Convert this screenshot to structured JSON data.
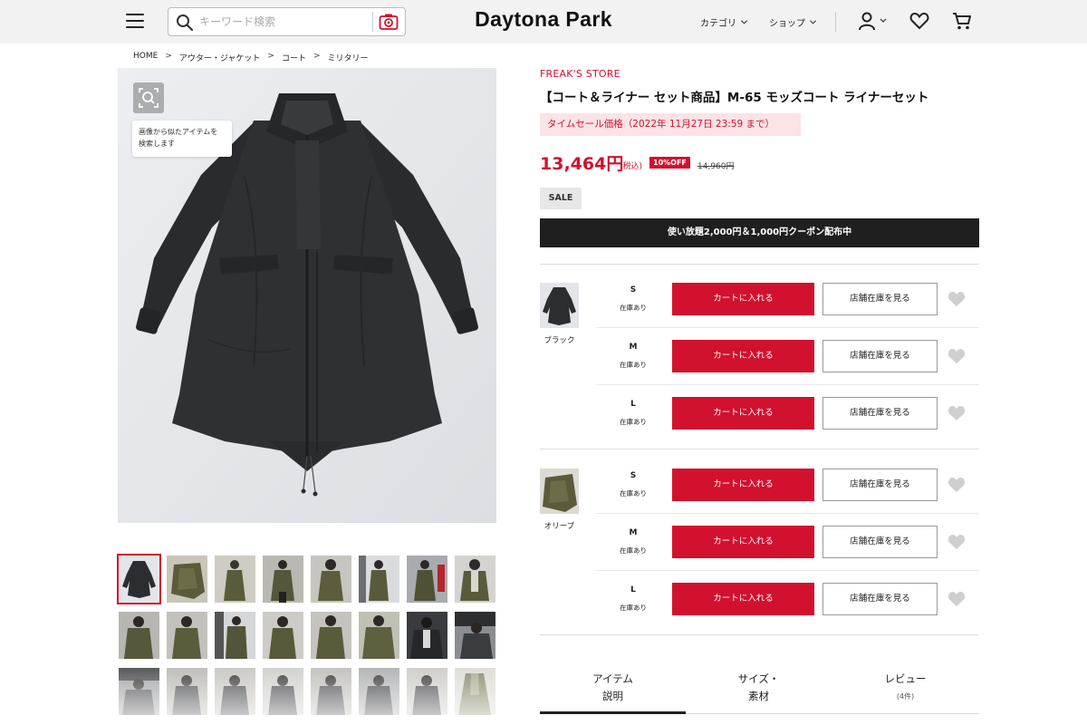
{
  "header": {
    "logo": "Daytona Park",
    "search_placeholder": "キーワード検索",
    "nav": [
      {
        "label": "カテゴリ"
      },
      {
        "label": "ショップ"
      }
    ]
  },
  "breadcrumb": [
    "HOME",
    "アウター・ジャケット",
    "コート",
    "ミリタリー"
  ],
  "image_search": {
    "tooltip_line1": "画像から似たアイテムを",
    "tooltip_line2": "検索します"
  },
  "product": {
    "brand": "FREAK'S STORE",
    "title": "【コート＆ライナー セット商品】M-65 モッズコート ライナーセット",
    "sale_banner": "タイムセール価格（2022年 11月27日 23:59 まで）",
    "price": "13,464円",
    "tax_note": "(税込)",
    "discount_badge": "10%OFF",
    "original_price": "14,960円",
    "sale_tag": "SALE",
    "coupon_banner": "使い放題2,000円＆1,000円クーポン配布中"
  },
  "variants": [
    {
      "color": "ブラック",
      "sizes": [
        {
          "size": "S",
          "stock": "在庫あり",
          "cart_label": "カートに入れる",
          "store_label": "店舗在庫を見る"
        },
        {
          "size": "M",
          "stock": "在庫あり",
          "cart_label": "カートに入れる",
          "store_label": "店舗在庫を見る"
        },
        {
          "size": "L",
          "stock": "在庫あり",
          "cart_label": "カートに入れる",
          "store_label": "店舗在庫を見る"
        }
      ]
    },
    {
      "color": "オリーブ",
      "sizes": [
        {
          "size": "S",
          "stock": "在庫あり",
          "cart_label": "カートに入れる",
          "store_label": "店舗在庫を見る"
        },
        {
          "size": "M",
          "stock": "在庫あり",
          "cart_label": "カートに入れる",
          "store_label": "店舗在庫を見る"
        },
        {
          "size": "L",
          "stock": "在庫あり",
          "cart_label": "カートに入れる",
          "store_label": "店舗在庫を見る"
        }
      ]
    }
  ],
  "tabs": [
    {
      "line1": "アイテム",
      "line2": "説明"
    },
    {
      "line1": "サイズ・",
      "line2": "素材"
    },
    {
      "line1": "レビュー",
      "line2": "(4件)"
    }
  ],
  "colors": {
    "accent": "#d1112e",
    "sale_banner_bg": "#fbe3e6",
    "coupon_bg": "#1f1f1f",
    "header_bg": "#f2f2f2"
  }
}
